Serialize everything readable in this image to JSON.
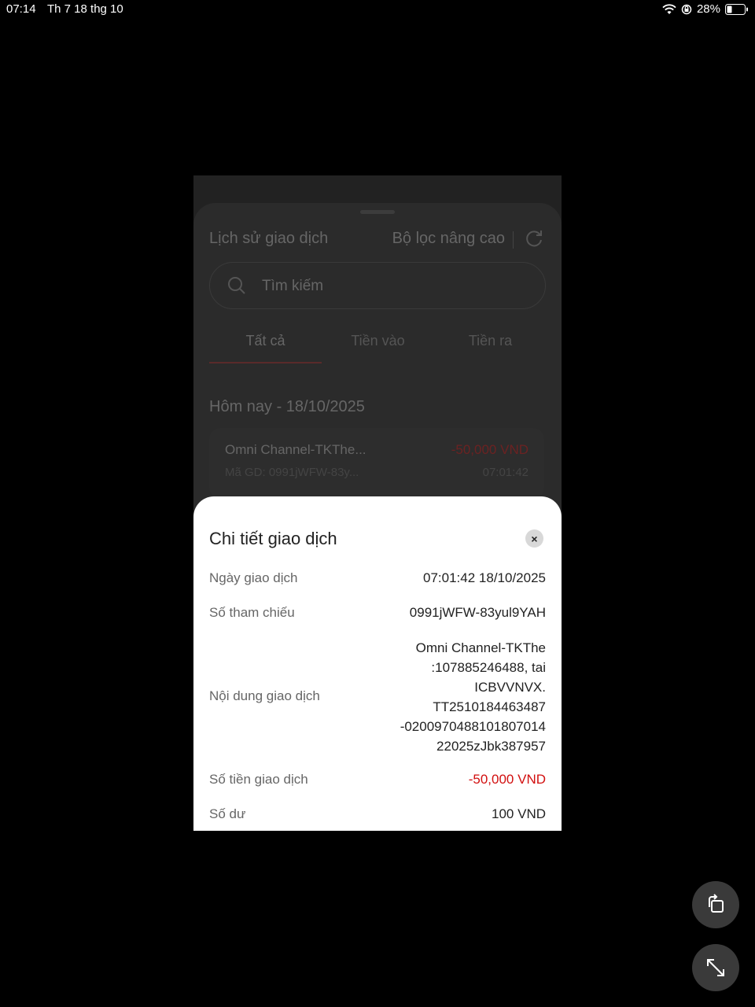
{
  "status_bar": {
    "time": "07:14",
    "date": "Th 7 18 thg 10",
    "battery": "28%"
  },
  "background_screen": {
    "title": "Lịch sử giao dịch",
    "advanced_filter": "Bộ lọc nâng cao",
    "search_placeholder": "Tìm kiếm",
    "tabs": [
      "Tất cả",
      "Tiền vào",
      "Tiền ra"
    ],
    "date_header": "Hôm nay - 18/10/2025",
    "transaction": {
      "name": "Omni Channel-TKThe...",
      "amount": "-50,000 VND",
      "code": "Mã GD: 0991jWFW-83y...",
      "time": "07:01:42"
    }
  },
  "modal": {
    "title": "Chi tiết giao dịch",
    "close_label": "×",
    "rows": [
      {
        "label": "Ngày giao dịch",
        "value": "07:01:42 18/10/2025"
      },
      {
        "label": "Số tham chiếu",
        "value": "0991jWFW-83yul9YAH"
      },
      {
        "label": "Nội dung giao dịch",
        "value_lines": [
          "Omni Channel-TKThe",
          ":107885246488, tai",
          "ICBVVNVX.",
          "TT2510184463487",
          "-0200970488101807014",
          "22025zJbk387957"
        ]
      },
      {
        "label": "Số tiền giao dịch",
        "value": "-50,000 VND"
      },
      {
        "label": "Số dư",
        "value": "100 VND"
      }
    ]
  },
  "colors": {
    "negative_amount": "#d20f0f",
    "tab_active_underline": "#5a2a2a"
  },
  "icons": [
    "wifi-icon",
    "rotation-lock-icon",
    "battery-icon",
    "refresh-icon",
    "search-icon",
    "close-icon",
    "rotate-screen-icon",
    "expand-icon"
  ]
}
